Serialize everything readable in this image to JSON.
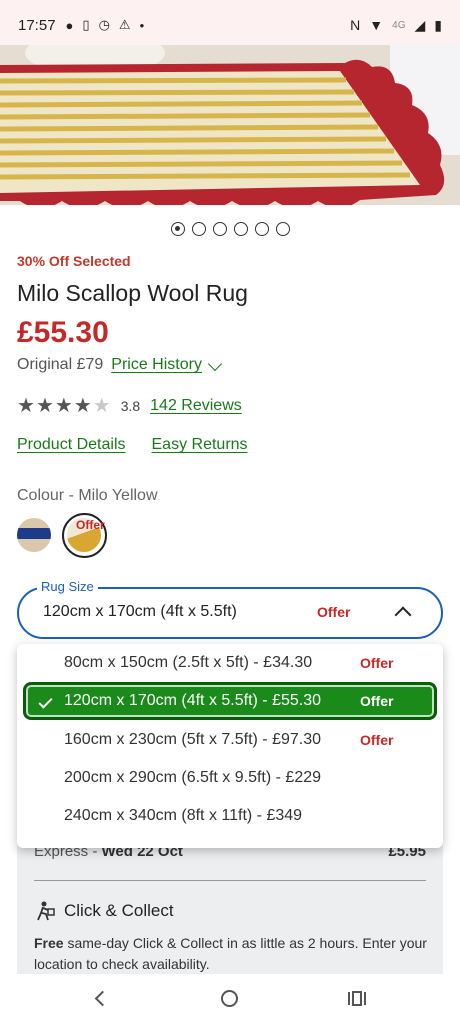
{
  "status_bar": {
    "time": "17:57",
    "network": "4G"
  },
  "carousel": {
    "dots": 6,
    "active_index": 0
  },
  "product": {
    "offer_tag": "30% Off Selected",
    "title": "Milo Scallop Wool Rug",
    "price": "£55.30",
    "original_price": "Original £79",
    "price_history_link": "Price History",
    "rating_value": "3.8",
    "rating_stars": 3.8,
    "reviews_link": "142 Reviews",
    "product_details_link": "Product Details",
    "easy_returns_link": "Easy Returns",
    "colour_label": "Colour - Milo Yellow",
    "swatch_offer": "Offer"
  },
  "size_select": {
    "legend": "Rug Size",
    "value": "120cm x 170cm (4ft x 5.5ft)",
    "offer": "Offer",
    "options": [
      {
        "label": "80cm x 150cm (2.5ft x 5ft) - £34.30",
        "offer": "Offer",
        "selected": false
      },
      {
        "label": "120cm x 170cm (4ft x 5.5ft) - £55.30",
        "offer": "Offer",
        "selected": true
      },
      {
        "label": "160cm x 230cm (5ft x 7.5ft) - £97.30",
        "offer": "Offer",
        "selected": false
      },
      {
        "label": "200cm x 290cm (6.5ft x 9.5ft) - £229",
        "offer": "",
        "selected": false
      },
      {
        "label": "240cm x 340cm (8ft x 11ft) - £349",
        "offer": "",
        "selected": false
      }
    ]
  },
  "delivery": {
    "express_label": "Express - ",
    "express_date": "Wed 22 Oct",
    "express_price": "£5.95",
    "cc_title": "Click & Collect",
    "cc_text_bold": "Free",
    "cc_text": " same-day Click & Collect in as little as 2 hours. Enter your location to check availability."
  },
  "colors": {
    "accent_green": "#1a8a1a",
    "offer_red": "#c62828",
    "focus_blue": "#1b5fb8"
  }
}
